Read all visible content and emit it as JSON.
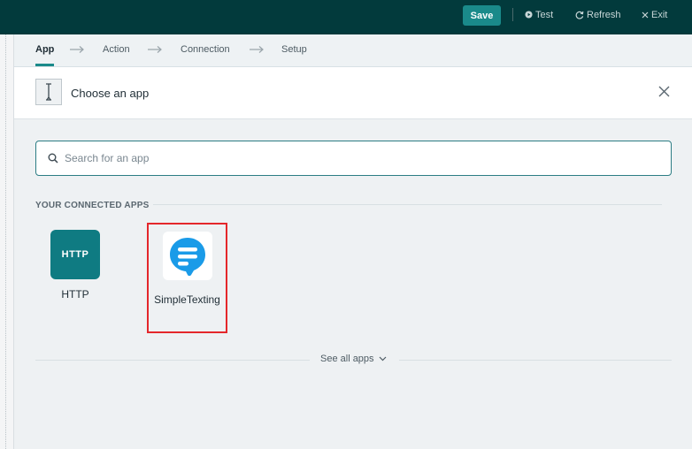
{
  "toolbar": {
    "save_label": "Save",
    "test_label": "Test",
    "refresh_label": "Refresh",
    "exit_label": "Exit"
  },
  "steps": [
    {
      "label": "App",
      "active": true
    },
    {
      "label": "Action",
      "active": false
    },
    {
      "label": "Connection",
      "active": false
    },
    {
      "label": "Setup",
      "active": false
    }
  ],
  "header": {
    "title": "Choose an app",
    "icon": "cursor-icon"
  },
  "search": {
    "placeholder": "Search for an app",
    "value": ""
  },
  "connected": {
    "title": "YOUR CONNECTED APPS",
    "apps": [
      {
        "name": "HTTP",
        "logo_text": "HTTP",
        "color": "#0f7b82"
      },
      {
        "name": "SimpleTexting",
        "icon": "chat-bubble-icon",
        "color": "#1a9be8",
        "highlighted": true
      }
    ]
  },
  "see_all": {
    "label": "See all apps"
  },
  "colors": {
    "topbar": "#023a3c",
    "accent": "#1a8a8a",
    "highlight": "#e4272b"
  }
}
